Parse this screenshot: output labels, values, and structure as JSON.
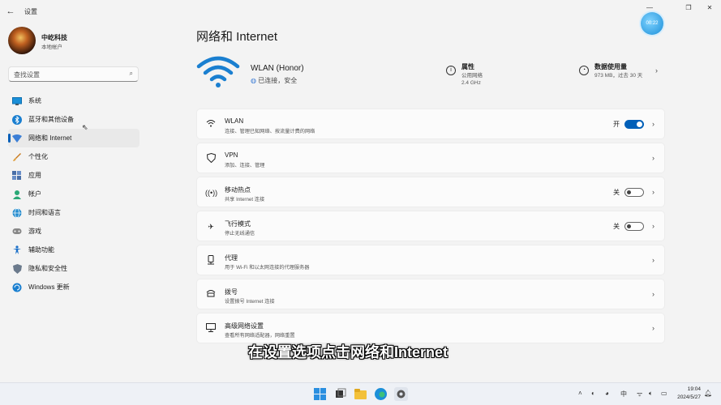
{
  "window": {
    "title": "设置",
    "back_glyph": "←",
    "minimize_glyph": "—",
    "maximize_glyph": "❐",
    "close_glyph": "✕",
    "watermark_text": "00:22"
  },
  "profile": {
    "name": "中屹科技",
    "account_type": "本地帐户"
  },
  "search": {
    "placeholder": "查找设置"
  },
  "nav": {
    "items": [
      {
        "label": "系统",
        "icon": "monitor-icon",
        "color": "#1a8fd8"
      },
      {
        "label": "蓝牙和其他设备",
        "icon": "bluetooth-icon",
        "color": "#1a7fd0"
      },
      {
        "label": "网络和 Internet",
        "icon": "network-icon",
        "color": "#3c7fd6",
        "active": true
      },
      {
        "label": "个性化",
        "icon": "brush-icon",
        "color": "#e08a2a"
      },
      {
        "label": "应用",
        "icon": "apps-icon",
        "color": "#4a6fa8"
      },
      {
        "label": "帐户",
        "icon": "account-icon",
        "color": "#2aa876"
      },
      {
        "label": "时间和语言",
        "icon": "globe-icon",
        "color": "#2a8fd0"
      },
      {
        "label": "游戏",
        "icon": "gamepad-icon",
        "color": "#777777"
      },
      {
        "label": "辅助功能",
        "icon": "accessibility-icon",
        "color": "#1a6fc8"
      },
      {
        "label": "隐私和安全性",
        "icon": "shield-icon",
        "color": "#6b7a8c"
      },
      {
        "label": "Windows 更新",
        "icon": "update-icon",
        "color": "#1a7fd0"
      }
    ]
  },
  "main": {
    "title": "网络和 Internet",
    "connection": {
      "name": "WLAN (Honor)",
      "status_icon": "globe-icon",
      "status": "已连接，安全"
    },
    "properties": {
      "title": "属性",
      "line1": "公用网络",
      "line2": "2.4 GHz"
    },
    "data_usage": {
      "title": "数据使用量",
      "detail": "973 MB，过去 30 天"
    },
    "cards": [
      {
        "icon": "wifi-icon",
        "title": "WLAN",
        "subtitle": "连接、管理已知网络、按流量计费的网络",
        "toggle_label": "开",
        "toggle_on": true
      },
      {
        "icon": "vpn-shield-icon",
        "title": "VPN",
        "subtitle": "添加、连接、管理"
      },
      {
        "icon": "hotspot-icon",
        "title": "移动热点",
        "subtitle": "共享 Internet 连接",
        "toggle_label": "关",
        "toggle_on": false
      },
      {
        "icon": "airplane-icon",
        "title": "飞行模式",
        "subtitle": "停止无线通信",
        "toggle_label": "关",
        "toggle_on": false
      },
      {
        "icon": "proxy-icon",
        "title": "代理",
        "subtitle": "用于 Wi-Fi 和以太网连接的代理服务器"
      },
      {
        "icon": "dialup-icon",
        "title": "拨号",
        "subtitle": "设置拨号 Internet 连接"
      },
      {
        "icon": "advanced-network-icon",
        "title": "高级网络设置",
        "subtitle": "查看所有网络适配器，网络重置"
      }
    ]
  },
  "caption": "在设置选项点击网络和Internet",
  "taskbar": {
    "time": "19:04",
    "date": "2024/5/27",
    "accent": "#005fb8"
  }
}
